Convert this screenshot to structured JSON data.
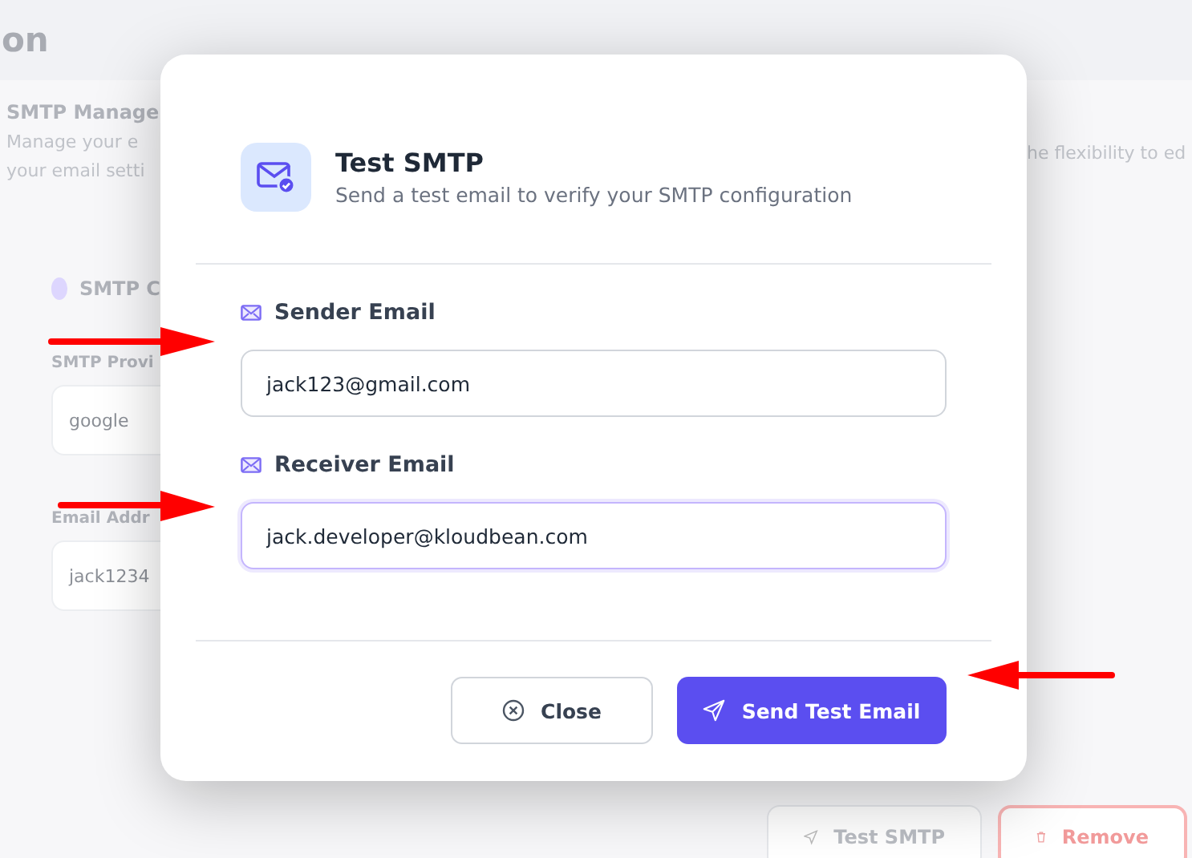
{
  "background": {
    "page_title": "on",
    "section_title": "SMTP Manage",
    "description_lines": [
      "Manage your e",
      "your email setti"
    ],
    "description_right": "he flexibility to ed",
    "card_title": "SMTP C",
    "fields": [
      {
        "label": "SMTP Provi",
        "value": "google"
      },
      {
        "label": "Email Addr",
        "value": "jack1234"
      }
    ],
    "buttons": [
      {
        "label": "Test SMTP",
        "kind": "secondary"
      },
      {
        "label": "Remove",
        "kind": "danger"
      }
    ]
  },
  "dialog": {
    "title": "Test SMTP",
    "subtitle": "Send a test email to verify your SMTP configuration",
    "fields": [
      {
        "label": "Sender Email",
        "value": "jack123@gmail.com",
        "focused": false
      },
      {
        "label": "Receiver Email",
        "value": "jack.developer@kloudbean.com",
        "focused": true
      }
    ],
    "buttons": [
      {
        "label": "Close",
        "kind": "secondary"
      },
      {
        "label": "Send Test Email",
        "kind": "primary"
      }
    ]
  }
}
